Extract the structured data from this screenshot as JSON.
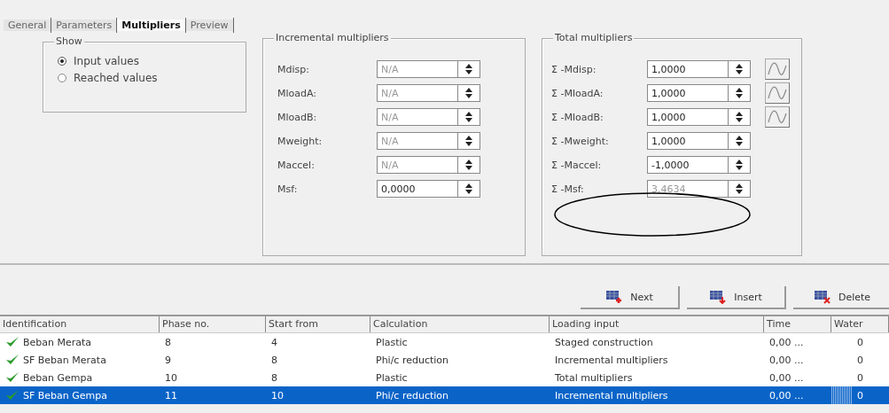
{
  "tabs": [
    {
      "label": "General",
      "selected": false
    },
    {
      "label": "Parameters",
      "selected": false
    },
    {
      "label": "Multipliers",
      "selected": true
    },
    {
      "label": "Preview",
      "selected": false
    }
  ],
  "show": {
    "title": "Show",
    "options": [
      {
        "label": "Input values",
        "selected": true
      },
      {
        "label": "Reached values",
        "selected": false
      }
    ]
  },
  "incremental": {
    "title": "Incremental multipliers",
    "fields": [
      {
        "label": "Mdisp:",
        "value": "N/A",
        "disabled": true
      },
      {
        "label": "MloadA:",
        "value": "N/A",
        "disabled": true
      },
      {
        "label": "MloadB:",
        "value": "N/A",
        "disabled": true
      },
      {
        "label": "Mweight:",
        "value": "N/A",
        "disabled": true
      },
      {
        "label": "Maccel:",
        "value": "N/A",
        "disabled": true
      },
      {
        "label": "Msf:",
        "value": "0,0000",
        "disabled": false
      }
    ]
  },
  "total": {
    "title": "Total multipliers",
    "fields": [
      {
        "label": "Σ -Mdisp:",
        "value": "1,0000",
        "disabled": false,
        "curve": true
      },
      {
        "label": "Σ -MloadA:",
        "value": "1,0000",
        "disabled": false,
        "curve": true
      },
      {
        "label": "Σ -MloadB:",
        "value": "1,0000",
        "disabled": false,
        "curve": true
      },
      {
        "label": "Σ -Mweight:",
        "value": "1,0000",
        "disabled": false,
        "curve": false
      },
      {
        "label": "Σ -Maccel:",
        "value": "-1,0000",
        "disabled": false,
        "curve": false
      },
      {
        "label": "Σ -Msf:",
        "value": "3,4634",
        "disabled": true,
        "curve": false
      }
    ]
  },
  "buttons": [
    {
      "label": "Next",
      "kind": "next"
    },
    {
      "label": "Insert",
      "kind": "insert"
    },
    {
      "label": "Delete",
      "kind": "delete"
    }
  ],
  "table": {
    "columns": [
      "Identification",
      "Phase no.",
      "Start from",
      "Calculation",
      "Loading input",
      "Time",
      "Water"
    ],
    "rows": [
      {
        "cells": [
          "Beban Merata",
          "8",
          "4",
          "Plastic",
          "Staged construction",
          "0,00 ...",
          "0"
        ],
        "selected": false
      },
      {
        "cells": [
          "SF Beban Merata",
          "9",
          "8",
          "Phi/c reduction",
          "Incremental multipliers",
          "0,00 ...",
          "0"
        ],
        "selected": false
      },
      {
        "cells": [
          "Beban Gempa",
          "10",
          "8",
          "Plastic",
          "Total multipliers",
          "0,00 ...",
          "0"
        ],
        "selected": false
      },
      {
        "cells": [
          "SF Beban Gempa",
          "11",
          "10",
          "Phi/c reduction",
          "Incremental multipliers",
          "0,00 ...",
          "0"
        ],
        "selected": true
      }
    ]
  }
}
